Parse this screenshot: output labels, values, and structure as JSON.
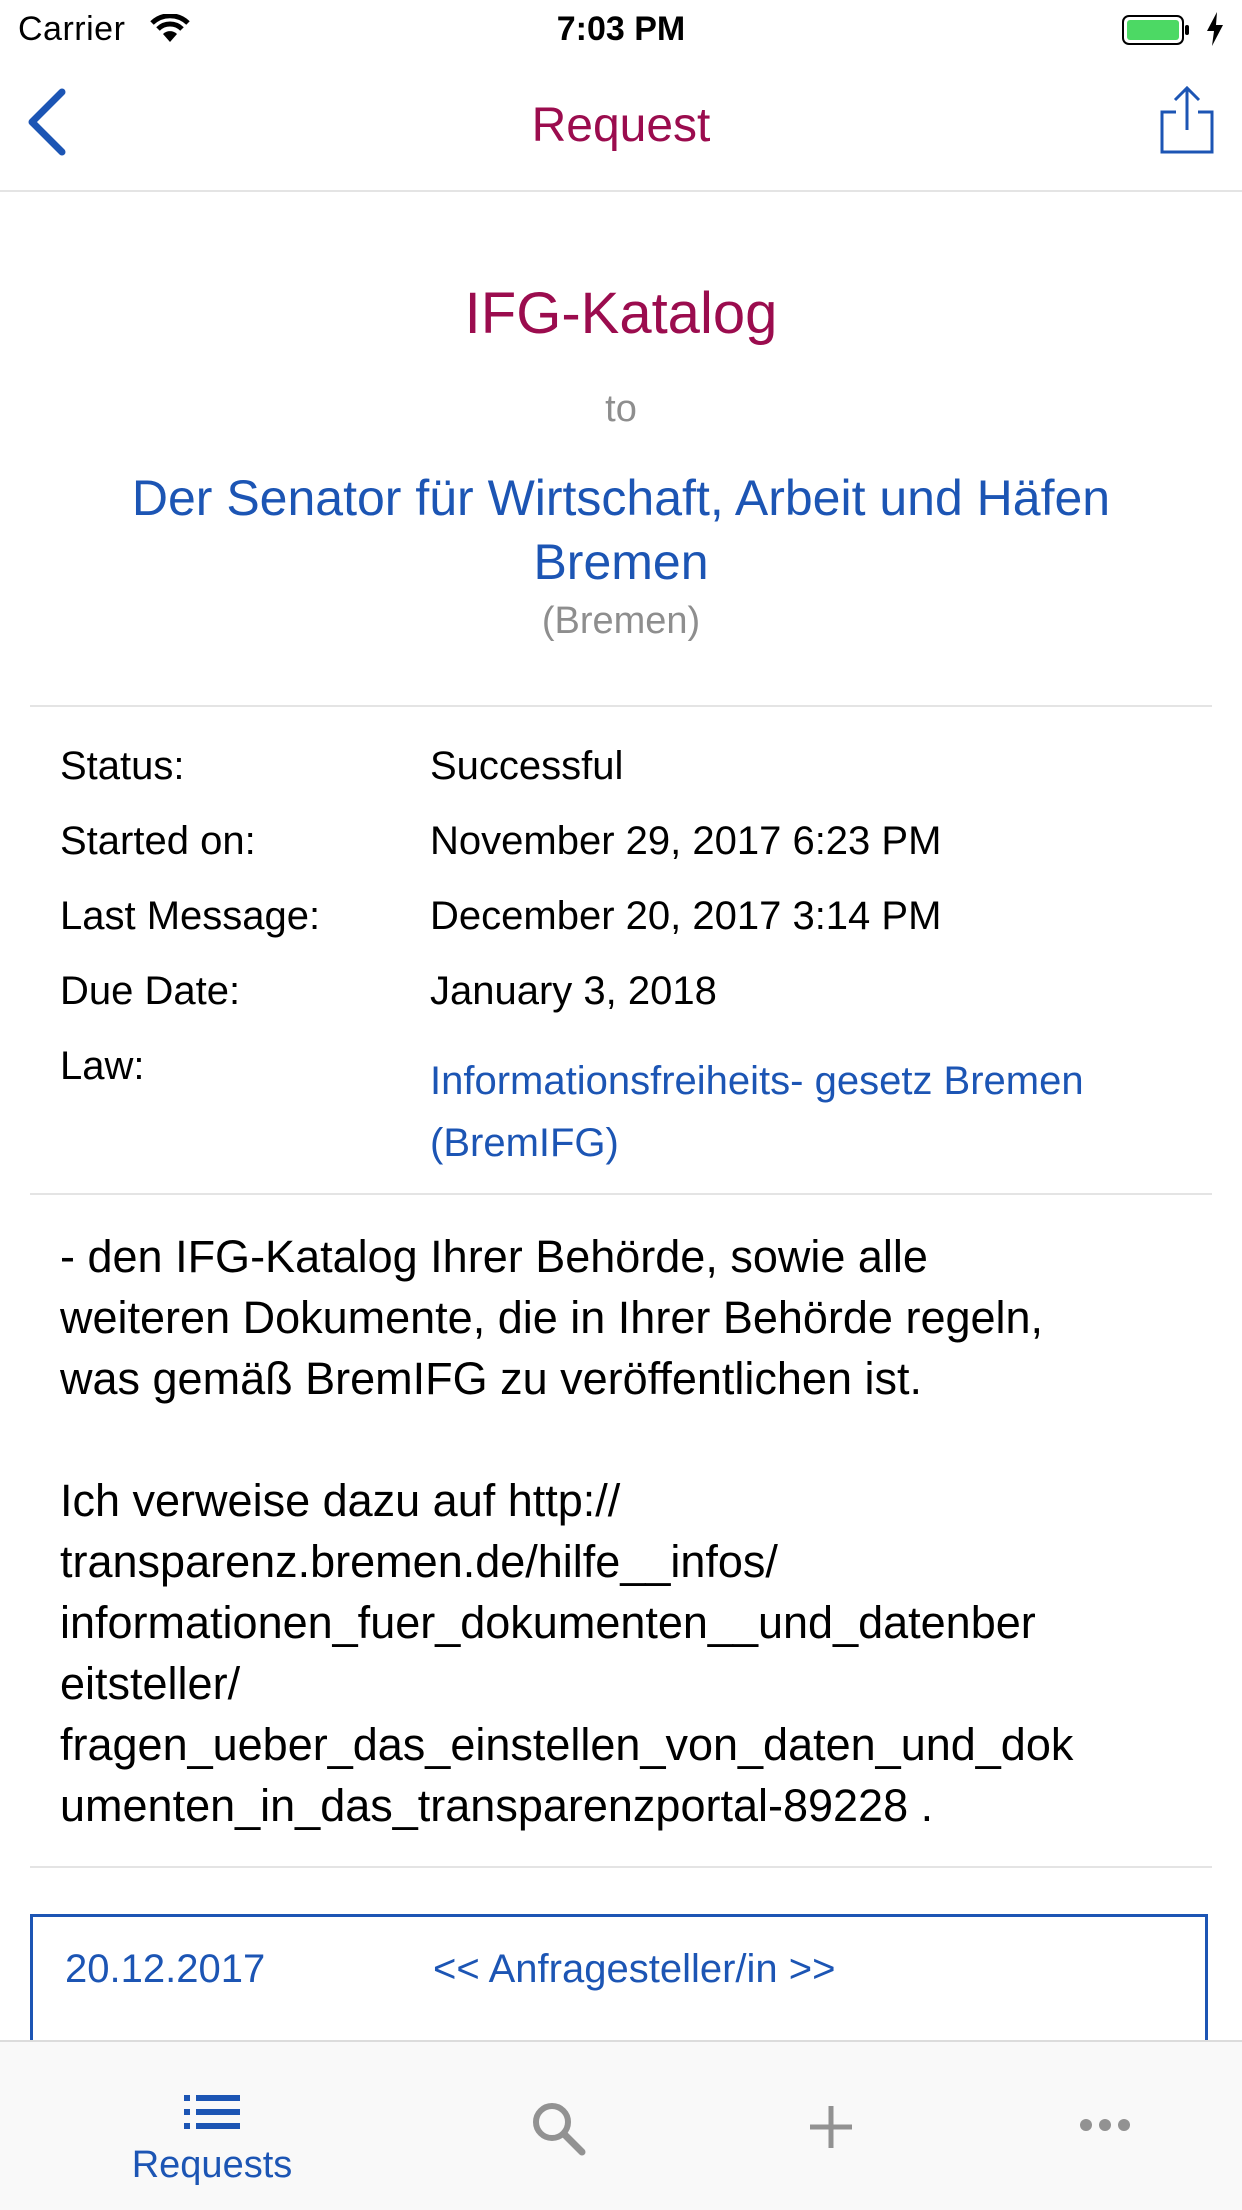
{
  "status_bar": {
    "carrier": "Carrier",
    "time": "7:03 PM"
  },
  "nav": {
    "title": "Request"
  },
  "request": {
    "title": "IFG-Katalog",
    "to_label": "to",
    "authority": "Der Senator für Wirtschaft, Arbeit und Häfen Bremen",
    "jurisdiction": "(Bremen)"
  },
  "info": {
    "status_label": "Status:",
    "status_value": "Successful",
    "started_label": "Started on:",
    "started_value": "November 29, 2017 6:23 PM",
    "last_label": "Last Message:",
    "last_value": "December 20, 2017 3:14 PM",
    "due_label": "Due Date:",
    "due_value": "January 3, 2018",
    "law_label": "Law:",
    "law_value": "Informationsfreiheits- gesetz Bremen (BremIFG)"
  },
  "body": {
    "text": "- den IFG-Katalog Ihrer Behörde, sowie alle\nweiteren Dokumente, die in Ihrer Behörde regeln,\nwas gemäß BremIFG zu veröffentlichen ist.\n\nIch verweise dazu auf http://\ntransparenz.bremen.de/hilfe__infos/\ninformationen_fuer_dokumenten__und_datenber\neitsteller/\nfragen_ueber_das_einstellen_von_daten_und_dok\numenten_in_das_transparenzportal-89228 ."
  },
  "message": {
    "date": "20.12.2017",
    "sender": "<< Anfragesteller/in >>"
  },
  "tabs": [
    {
      "label": "Requests",
      "icon": "list-icon"
    },
    {
      "label": "",
      "icon": "search-icon"
    },
    {
      "label": "",
      "icon": "plus-icon"
    },
    {
      "label": "",
      "icon": "more-icon"
    }
  ],
  "colors": {
    "accent": "#1c55b4",
    "title": "#9b0c4e",
    "muted": "#8e8e8e",
    "battery": "#4cd964"
  }
}
